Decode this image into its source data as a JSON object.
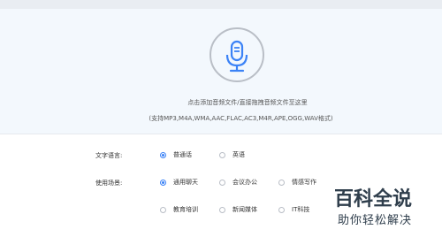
{
  "upload": {
    "icon": "microphone-icon",
    "hint": "点击添加音频文件/直接拖拽音频文件至这里",
    "formats": "(支持MP3,M4A,WMA,AAC,FLAC,AC3,M4R,APE,OGG,WAV格式)"
  },
  "language": {
    "label": "文字语言:",
    "options": [
      {
        "label": "普通话",
        "selected": true
      },
      {
        "label": "英语",
        "selected": false
      }
    ]
  },
  "scene": {
    "label": "使用场景:",
    "options": [
      {
        "label": "通用聊天",
        "selected": true
      },
      {
        "label": "会议办公",
        "selected": false
      },
      {
        "label": "情感写作",
        "selected": false
      },
      {
        "label": "教育培训",
        "selected": false
      },
      {
        "label": "新闻媒体",
        "selected": false
      },
      {
        "label": "IT科技",
        "selected": false
      }
    ]
  },
  "watermark": {
    "title": "百科全说",
    "subtitle": "助你轻松解决"
  },
  "colors": {
    "accent": "#3b82f6",
    "upload_bg": "#f3f8fd"
  }
}
